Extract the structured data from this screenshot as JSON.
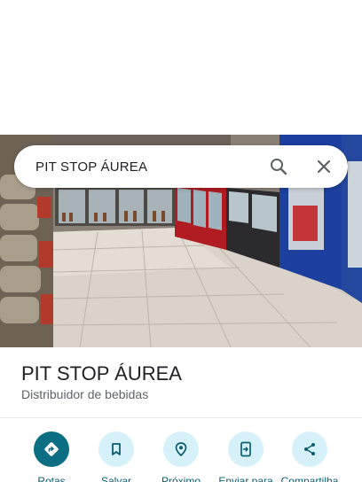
{
  "search": {
    "query": "PIT STOP ÁUREA"
  },
  "place": {
    "name": "PIT STOP ÁUREA",
    "category": "Distribuidor de bebidas"
  },
  "actions": [
    {
      "label": "Rotas",
      "icon": "directions-icon"
    },
    {
      "label": "Salvar",
      "icon": "bookmark-icon"
    },
    {
      "label": "Próximo",
      "icon": "nearby-icon"
    },
    {
      "label": "Enviar para",
      "icon": "send-to-phone-icon"
    },
    {
      "label": "Compartilha",
      "icon": "share-icon"
    }
  ],
  "colors": {
    "primary_action": "#0b6e82",
    "action_bg": "#d7f1fb",
    "action_text": "#0b5e70"
  }
}
